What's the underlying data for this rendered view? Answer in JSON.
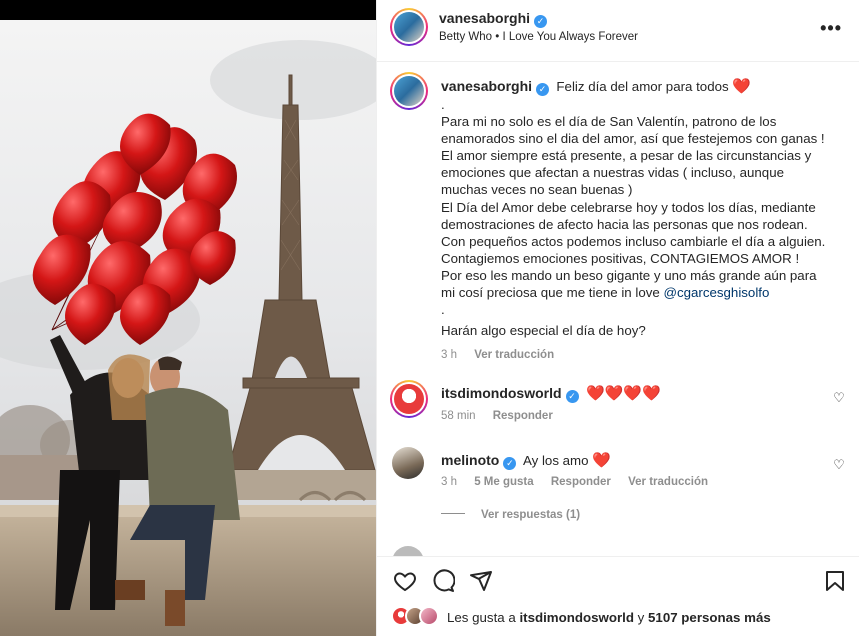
{
  "post": {
    "author": "vanesaborghi",
    "verified": true,
    "audio": "Betty Who • I Love You Always Forever",
    "more_icon": "more-horizontal-icon"
  },
  "caption": {
    "author": "vanesaborghi",
    "lines": [
      "Feliz día del amor para todos",
      ".",
      "Para mi no solo es el día de San Valentín, patrono de los",
      "enamorados sino el dia del amor, así que festejemos con ganas !",
      "El amor siempre está presente, a pesar de las circunstancias y",
      "emociones que afectan a nuestras vidas ( incluso, aunque",
      "muchas veces no sean buenas )",
      "El Día del Amor debe celebrarse hoy y todos los días, mediante",
      "demostraciones de afecto hacia las personas que nos rodean.",
      "Con pequeños actos podemos incluso cambiarle el día a alguien.",
      "Contagiemos emociones positivas, CONTAGIEMOS AMOR !",
      "Por eso les mando un beso gigante y uno más grande aún para",
      "mi cosí preciosa que me tiene in love",
      ".",
      "Harán algo especial el día de hoy?"
    ],
    "mention": "@cgarcesghisolfo",
    "heart": "❤️",
    "time": "3 h",
    "translate": "Ver traducción"
  },
  "comments": [
    {
      "author": "itsdimondosworld",
      "verified": true,
      "text": "❤️❤️❤️❤️",
      "time": "58 min",
      "reply": "Responder"
    },
    {
      "author": "melinoto",
      "verified": true,
      "text": "Ay los amo",
      "heart": "❤️",
      "time": "3 h",
      "likes": "5 Me gusta",
      "reply": "Responder",
      "translate": "Ver traducción",
      "view_replies": "Ver respuestas (1)"
    }
  ],
  "likes": {
    "prefix": "Les gusta a",
    "user": "itsdimondosworld",
    "middle": "y",
    "others": "5107 personas más"
  },
  "colors": {
    "verified": "#3897f0",
    "heart": "#e0201e",
    "muted": "#8e8e8e",
    "link": "#00376b"
  }
}
